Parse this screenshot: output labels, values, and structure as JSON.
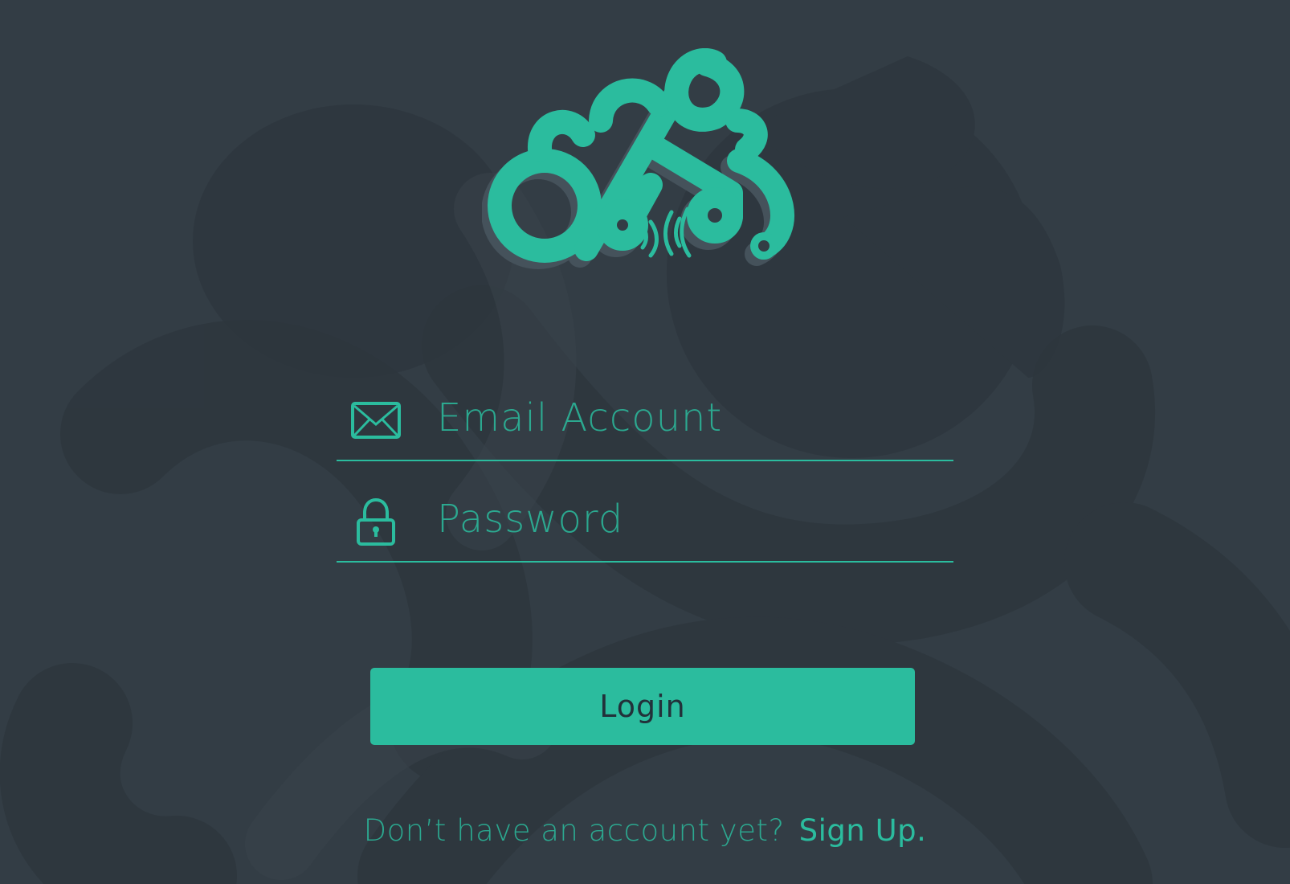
{
  "app": {
    "accent_color": "#2bbc9e",
    "background_color": "#333d45"
  },
  "logo": {
    "icon": "bicycle-circuit-logo"
  },
  "email_field": {
    "placeholder": "Email Account",
    "value": "",
    "icon": "envelope-icon"
  },
  "password_field": {
    "placeholder": "Password",
    "value": "",
    "icon": "lock-icon"
  },
  "login_button": {
    "label": "Login"
  },
  "signup": {
    "prompt": "Don’t have an account yet?",
    "link_label": "Sign Up."
  }
}
